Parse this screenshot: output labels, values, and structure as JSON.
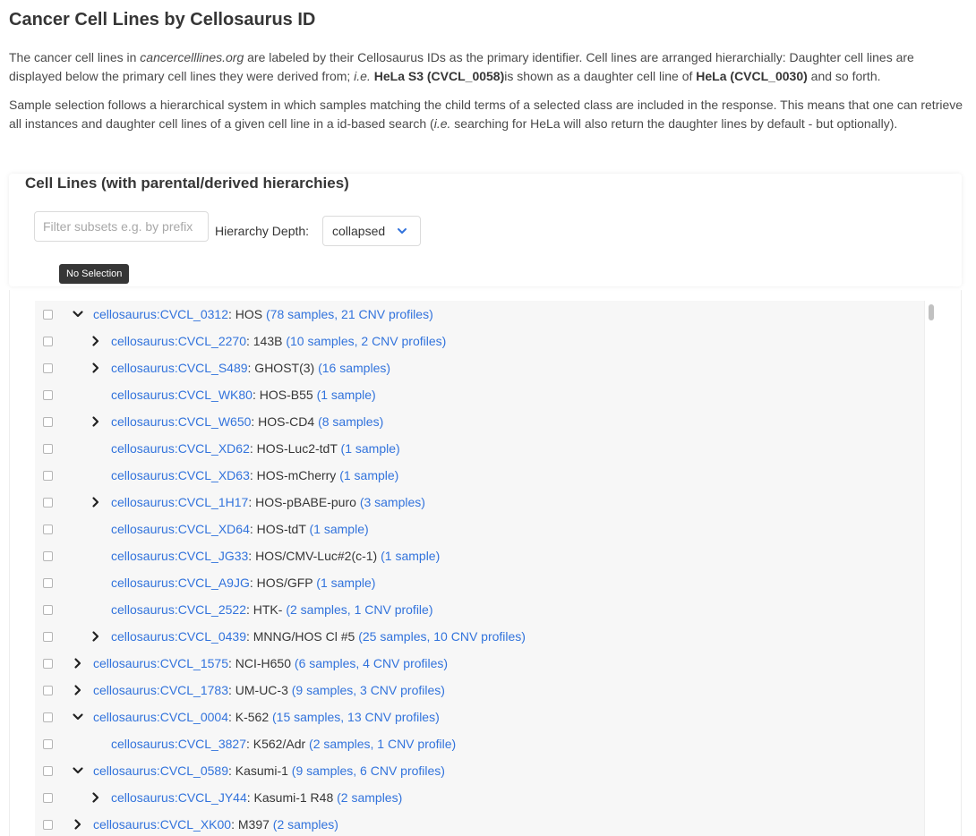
{
  "page": {
    "title": "Cancer Cell Lines by Cellosaurus ID",
    "intro1": {
      "a": "The cancer cell lines in ",
      "site": "cancercelllines.org",
      "b": " are labeled by their Cellosaurus IDs as the primary identifier. Cell lines are arranged hierarchially: Daughter cell lines are displayed below the primary cell lines they were derived from; ",
      "ie": "i.e.",
      "child": "HeLa S3 (CVCL_0058)",
      "c": "is shown as a daughter cell line of ",
      "parent": "HeLa (CVCL_0030)",
      "d": " and so forth."
    },
    "intro2": {
      "a": "Sample selection follows a hierarchical system in which samples matching the child terms of a selected class are included in the response. This means that one can retrieve all instances and daughter cell lines of a given cell line in a id-based search (",
      "ie": "i.e.",
      "b": " searching for HeLa will also return the daughter lines by default - but optionally)."
    }
  },
  "panel": {
    "title": "Cell Lines (with parental/derived hierarchies)",
    "filter_placeholder": "Filter subsets e.g. by prefix",
    "depth_label": "Hierarchy Depth:",
    "depth_value": "collapsed",
    "tooltip": "No Selection"
  },
  "colors": {
    "link": "#3273dc",
    "text": "#363636"
  },
  "tree": [
    {
      "level": 0,
      "caret": "down",
      "id": "cellosaurus:CVCL_0312",
      "name": ": HOS ",
      "count": "(78 samples, 21 CNV profiles)"
    },
    {
      "level": 1,
      "caret": "right",
      "id": "cellosaurus:CVCL_2270",
      "name": ": 143B ",
      "count": "(10 samples, 2 CNV profiles)"
    },
    {
      "level": 1,
      "caret": "right",
      "id": "cellosaurus:CVCL_S489",
      "name": ": GHOST(3) ",
      "count": "(16 samples)"
    },
    {
      "level": 1,
      "caret": "none",
      "id": "cellosaurus:CVCL_WK80",
      "name": ": HOS-B55 ",
      "count": "(1 sample)"
    },
    {
      "level": 1,
      "caret": "right",
      "id": "cellosaurus:CVCL_W650",
      "name": ": HOS-CD4 ",
      "count": "(8 samples)"
    },
    {
      "level": 1,
      "caret": "none",
      "id": "cellosaurus:CVCL_XD62",
      "name": ": HOS-Luc2-tdT ",
      "count": "(1 sample)"
    },
    {
      "level": 1,
      "caret": "none",
      "id": "cellosaurus:CVCL_XD63",
      "name": ": HOS-mCherry ",
      "count": "(1 sample)"
    },
    {
      "level": 1,
      "caret": "right",
      "id": "cellosaurus:CVCL_1H17",
      "name": ": HOS-pBABE-puro ",
      "count": "(3 samples)"
    },
    {
      "level": 1,
      "caret": "none",
      "id": "cellosaurus:CVCL_XD64",
      "name": ": HOS-tdT ",
      "count": "(1 sample)"
    },
    {
      "level": 1,
      "caret": "none",
      "id": "cellosaurus:CVCL_JG33",
      "name": ": HOS/CMV-Luc#2(c-1) ",
      "count": "(1 sample)"
    },
    {
      "level": 1,
      "caret": "none",
      "id": "cellosaurus:CVCL_A9JG",
      "name": ": HOS/GFP ",
      "count": "(1 sample)"
    },
    {
      "level": 1,
      "caret": "none",
      "id": "cellosaurus:CVCL_2522",
      "name": ": HTK- ",
      "count": "(2 samples, 1 CNV profile)"
    },
    {
      "level": 1,
      "caret": "right",
      "id": "cellosaurus:CVCL_0439",
      "name": ": MNNG/HOS Cl #5 ",
      "count": "(25 samples, 10 CNV profiles)"
    },
    {
      "level": 0,
      "caret": "right",
      "id": "cellosaurus:CVCL_1575",
      "name": ": NCI-H650 ",
      "count": "(6 samples, 4 CNV profiles)"
    },
    {
      "level": 0,
      "caret": "right",
      "id": "cellosaurus:CVCL_1783",
      "name": ": UM-UC-3 ",
      "count": "(9 samples, 3 CNV profiles)"
    },
    {
      "level": 0,
      "caret": "down",
      "id": "cellosaurus:CVCL_0004",
      "name": ": K-562 ",
      "count": "(15 samples, 13 CNV profiles)"
    },
    {
      "level": 1,
      "caret": "none",
      "id": "cellosaurus:CVCL_3827",
      "name": ": K562/Adr ",
      "count": "(2 samples, 1 CNV profile)"
    },
    {
      "level": 0,
      "caret": "down",
      "id": "cellosaurus:CVCL_0589",
      "name": ": Kasumi-1 ",
      "count": "(9 samples, 6 CNV profiles)"
    },
    {
      "level": 1,
      "caret": "right",
      "id": "cellosaurus:CVCL_JY44",
      "name": ": Kasumi-1 R48 ",
      "count": "(2 samples)"
    },
    {
      "level": 0,
      "caret": "right",
      "id": "cellosaurus:CVCL_XK00",
      "name": ": M397 ",
      "count": "(2 samples)"
    }
  ]
}
